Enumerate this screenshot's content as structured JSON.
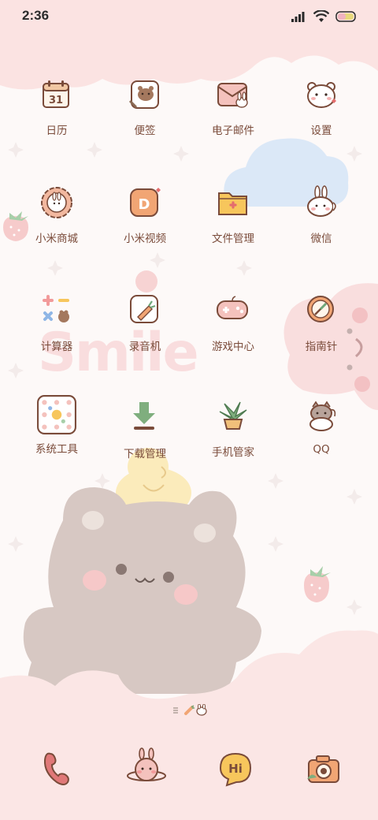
{
  "status_bar": {
    "time": "2:36",
    "icons": [
      "signal-icon",
      "wifi-icon",
      "battery-icon"
    ]
  },
  "apps": [
    {
      "label": "日历",
      "icon": "calendar-icon",
      "date_text": "31"
    },
    {
      "label": "便签",
      "icon": "notes-icon"
    },
    {
      "label": "电子邮件",
      "icon": "mail-icon"
    },
    {
      "label": "设置",
      "icon": "settings-bear-icon"
    },
    {
      "label": "小米商城",
      "icon": "mall-icon"
    },
    {
      "label": "小米视频",
      "icon": "video-icon",
      "glyph": "D"
    },
    {
      "label": "文件管理",
      "icon": "folder-icon"
    },
    {
      "label": "微信",
      "icon": "wechat-icon"
    },
    {
      "label": "计算器",
      "icon": "calculator-icon"
    },
    {
      "label": "录音机",
      "icon": "recorder-icon"
    },
    {
      "label": "游戏中心",
      "icon": "game-controller-icon"
    },
    {
      "label": "指南针",
      "icon": "compass-icon"
    },
    {
      "label": "系统工具",
      "icon": "system-tools-icon"
    },
    {
      "label": "下载管理",
      "icon": "download-icon"
    },
    {
      "label": "手机管家",
      "icon": "security-plant-icon"
    },
    {
      "label": "QQ",
      "icon": "qq-icon"
    }
  ],
  "wallpaper": {
    "smile_text": "Smile"
  },
  "dock": [
    {
      "icon": "phone-icon"
    },
    {
      "icon": "browser-bunny-planet-icon"
    },
    {
      "icon": "messages-hi-icon",
      "glyph": "Hi"
    },
    {
      "icon": "camera-icon"
    }
  ],
  "colors": {
    "background": "#fdf9f8",
    "pink_cloud": "#fbe3e2",
    "blue_cloud": "#dbe8f7",
    "bear": "#c9b7b1",
    "label": "#7a4b3a"
  }
}
